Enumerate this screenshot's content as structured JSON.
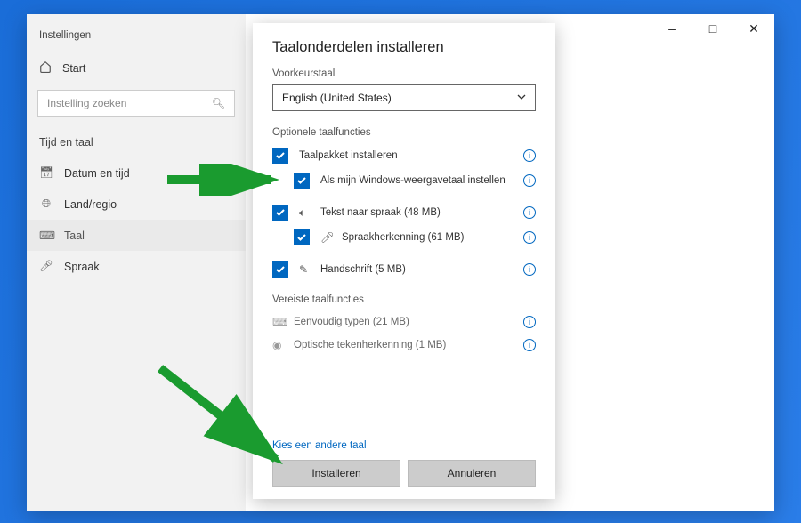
{
  "window": {
    "app_title": "Instellingen",
    "home_label": "Start",
    "search_placeholder": "Instelling zoeken",
    "section_title": "Tijd en taal",
    "nav": [
      {
        "label": "Datum en tijd"
      },
      {
        "label": "Land/regio"
      },
      {
        "label": "Taal"
      },
      {
        "label": "Spraak"
      }
    ]
  },
  "dialog": {
    "title": "Taalonderdelen installeren",
    "pref_lang_label": "Voorkeurstaal",
    "pref_lang_value": "English (United States)",
    "optional_label": "Optionele taalfuncties",
    "features": {
      "install_pack": "Taalpakket installeren",
      "display_lang": "Als mijn Windows-weergavetaal instellen",
      "tts": "Tekst naar spraak (48 MB)",
      "speech_rec": "Spraakherkenning (61 MB)",
      "handwriting": "Handschrift (5 MB)"
    },
    "required_label": "Vereiste taalfuncties",
    "required": {
      "basic_typing": "Eenvoudig typen (21 MB)",
      "ocr": "Optische tekenherkenning (1 MB)"
    },
    "choose_other_link": "Kies een andere taal",
    "install_btn": "Installeren",
    "cancel_btn": "Annuleren"
  }
}
